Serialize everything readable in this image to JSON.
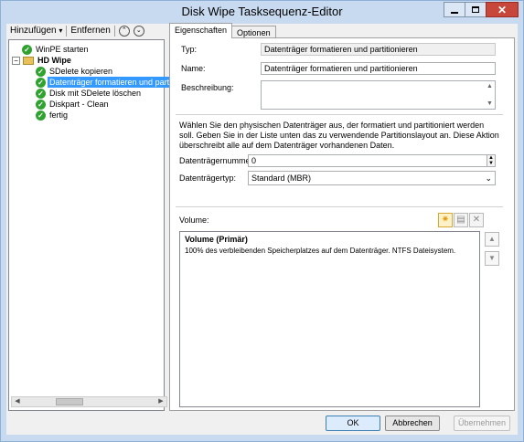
{
  "window": {
    "title": "Disk Wipe Tasksequenz-Editor"
  },
  "toolbar": {
    "add_label": "Hinzufügen",
    "add_arrow": "▾",
    "remove_label": "Entfernen"
  },
  "tree": {
    "items": [
      {
        "label": "WinPE starten",
        "level": 0,
        "icon": "check-icon"
      },
      {
        "label": "HD Wipe",
        "level": 0,
        "icon": "folder-icon",
        "bold": true
      },
      {
        "label": "SDelete kopieren",
        "level": 1,
        "icon": "check-icon"
      },
      {
        "label": "Datenträger formatieren und partiti",
        "level": 1,
        "icon": "check-icon",
        "selected": true
      },
      {
        "label": "Disk mit SDelete löschen",
        "level": 1,
        "icon": "check-icon"
      },
      {
        "label": "Diskpart - Clean",
        "level": 1,
        "icon": "check-icon"
      },
      {
        "label": "fertig",
        "level": 0,
        "icon": "check-icon"
      }
    ]
  },
  "tabs": [
    {
      "label": "Eigenschaften",
      "active": true
    },
    {
      "label": "Optionen",
      "active": false
    }
  ],
  "properties": {
    "type_label": "Typ:",
    "type_value": "Datenträger formatieren und partitionieren",
    "name_label": "Name:",
    "name_value": "Datenträger formatieren und partitionieren",
    "description_label": "Beschreibung:",
    "description_value": "",
    "instruction": "Wählen Sie den physischen Datenträger aus, der formatiert und partitioniert werden soll. Geben Sie in der Liste unten das zu verwendende Partitionslayout an. Diese Aktion überschreibt alle auf dem Datenträger vorhandenen Daten.",
    "disk_number_label": "Datenträgernummer:",
    "disk_number_value": "0",
    "disk_type_label": "Datenträgertyp:",
    "disk_type_value": "Standard (MBR)",
    "volume_label": "Volume:",
    "volume_title": "Volume (Primär)",
    "volume_detail": "100% des verbleibenden Speicherplatzes auf dem Datenträger. NTFS Dateisystem."
  },
  "buttons": {
    "ok": "OK",
    "cancel": "Abbrechen",
    "apply": "Übernehmen"
  },
  "colors": {
    "selection": "#3399ff",
    "check": "#2fa22f",
    "close": "#c7473b"
  }
}
